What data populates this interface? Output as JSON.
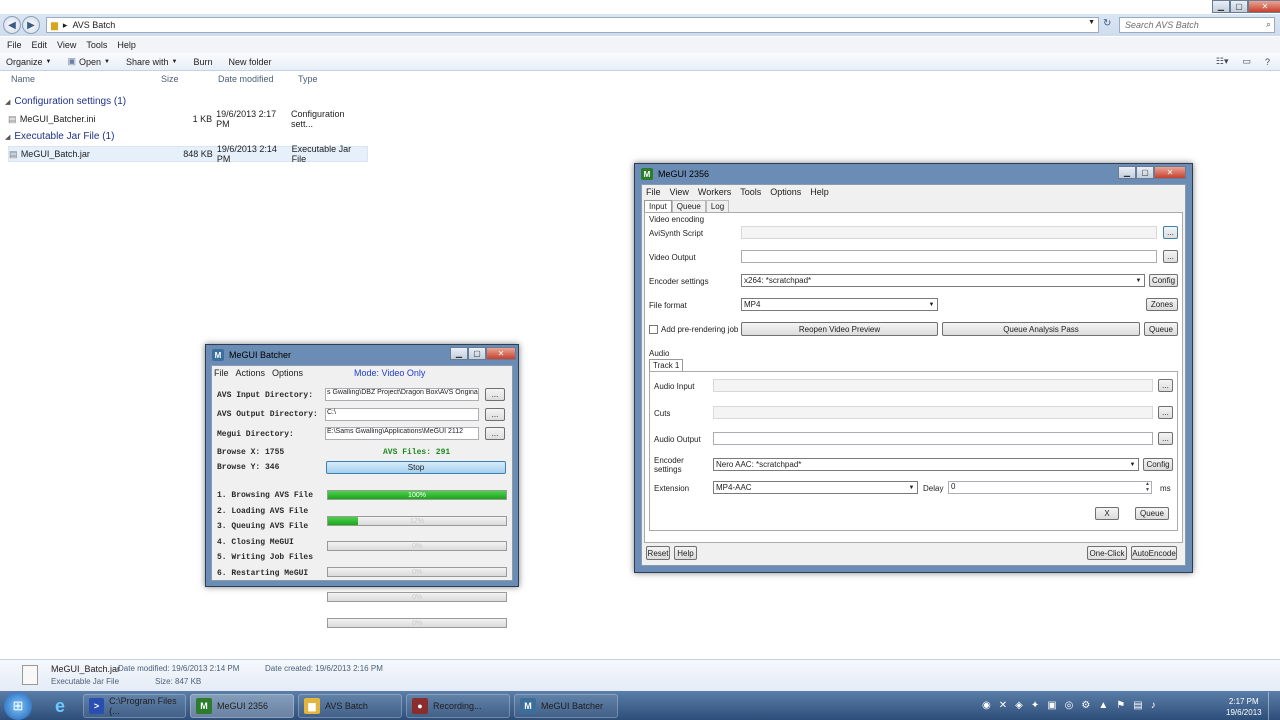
{
  "explorer": {
    "path": "AVS Batch",
    "search_placeholder": "Search AVS Batch",
    "menu": [
      "File",
      "Edit",
      "View",
      "Tools",
      "Help"
    ],
    "commands": {
      "organize": "Organize",
      "open": "Open",
      "share": "Share with",
      "burn": "Burn",
      "new_folder": "New folder"
    },
    "columns": {
      "name": "Name",
      "size": "Size",
      "date": "Date modified",
      "type": "Type"
    },
    "groups": [
      {
        "title": "Configuration settings (1)",
        "file": {
          "name": "MeGUI_Batcher.ini",
          "size": "1 KB",
          "date": "19/6/2013 2:17 PM",
          "type": "Configuration sett..."
        }
      },
      {
        "title": "Executable Jar File (1)",
        "file": {
          "name": "MeGUI_Batch.jar",
          "size": "848 KB",
          "date": "19/6/2013 2:14 PM",
          "type": "Executable Jar File"
        }
      }
    ],
    "details": {
      "name": "MeGUI_Batch.jar",
      "date_modified": "Date modified: 19/6/2013 2:14 PM",
      "date_created": "Date created: 19/6/2013 2:16 PM",
      "type": "Executable Jar File",
      "size": "Size: 847 KB"
    }
  },
  "batcher": {
    "title": "MeGUI Batcher",
    "menu": [
      "File",
      "Actions",
      "Options"
    ],
    "mode": "Mode: Video Only",
    "avs_input_label": "AVS Input Directory:",
    "avs_input_value": "s Gwalling\\DBZ Project\\Dragon Box\\AVS Original\\",
    "avs_output_label": "AVS Output Directory:",
    "avs_output_value": "C:\\",
    "megui_dir_label": "Megui Directory:",
    "megui_dir_value": "E:\\Sams Gwalling\\Applications\\MeGUI 2112",
    "browse_x": "Browse X: 1755",
    "browse_y": "Browse Y: 346",
    "avs_files": "AVS Files: 291",
    "stop": "Stop",
    "browse_btn": "...",
    "steps": [
      {
        "label": "1. Browsing AVS File",
        "percent": 100,
        "text": "100%"
      },
      {
        "label": "2. Loading AVS File",
        "percent": 17,
        "text": "17%"
      },
      {
        "label": "3. Queuing AVS File",
        "percent": 0,
        "text": "0%"
      },
      {
        "label": "4. Closing MeGUI",
        "percent": 0,
        "text": "0%"
      },
      {
        "label": "5. Writing Job Files",
        "percent": 0,
        "text": "0%"
      },
      {
        "label": "6. Restarting MeGUI",
        "percent": 0,
        "text": "0%"
      }
    ]
  },
  "megui": {
    "title": "MeGUI 2356",
    "menu": [
      "File",
      "View",
      "Workers",
      "Tools",
      "Options",
      "Help"
    ],
    "tabs": [
      "Input",
      "Queue",
      "Log"
    ],
    "video_section": "Video encoding",
    "avisynth": "AviSynth Script",
    "video_output": "Video Output",
    "encoder_settings": "Encoder settings",
    "encoder_value": "x264: *scratchpad*",
    "config": "Config",
    "file_format": "File format",
    "file_format_value": "MP4",
    "zones": "Zones",
    "add_prerender": "Add pre-rendering job",
    "reopen": "Reopen Video Preview",
    "queue_analysis": "Queue Analysis Pass",
    "queue": "Queue",
    "audio_section": "Audio",
    "track": "Track 1",
    "audio_input": "Audio Input",
    "cuts": "Cuts",
    "audio_output": "Audio Output",
    "audio_encoder_l1": "Encoder",
    "audio_encoder_l2": "settings",
    "audio_encoder_value": "Nero AAC: *scratchpad*",
    "extension": "Extension",
    "extension_value": "MP4-AAC",
    "delay": "Delay",
    "delay_value": "0",
    "ms": "ms",
    "x_btn": "X",
    "reset": "Reset",
    "help": "Help",
    "one_click": "One-Click",
    "auto_encode": "AutoEncode",
    "browse_btn": "..."
  },
  "taskbar": {
    "items": [
      "C:\\Program Files (...",
      "MeGUI 2356",
      "AVS Batch",
      "Recording...",
      "MeGUI Batcher"
    ],
    "time": "2:17 PM",
    "date": "19/6/2013"
  }
}
